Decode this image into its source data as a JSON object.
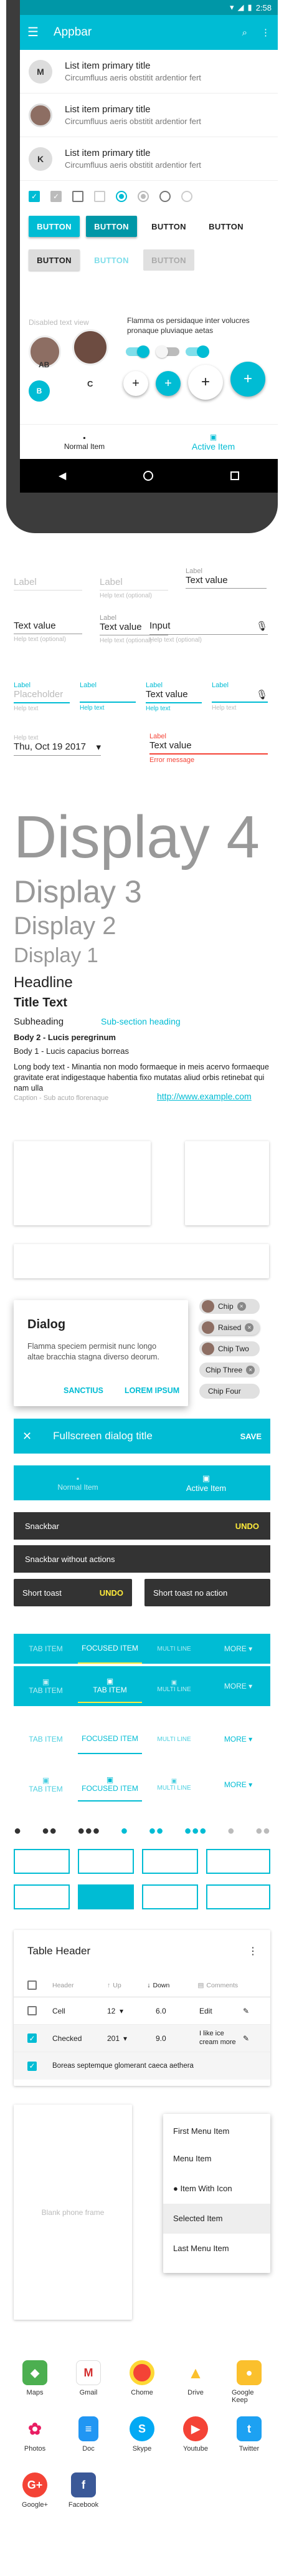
{
  "status": {
    "time": "2:58"
  },
  "appbar": {
    "title": "Appbar"
  },
  "list": [
    {
      "avatar": "M",
      "primary": "List item primary title",
      "secondary": "Circumfluus aeris obstitit ardentior fert"
    },
    {
      "avatar": "",
      "primary": "List item primary title",
      "secondary": "Circumfluus aeris obstitit ardentior fert"
    },
    {
      "avatar": "K",
      "primary": "List item primary title",
      "secondary": "Circumfluus aeris obstitit ardentior fert"
    }
  ],
  "buttons": {
    "row1": [
      "BUTTON",
      "BUTTON",
      "BUTTON",
      "BUTTON"
    ],
    "row2": [
      "BUTTON",
      "BUTTON",
      "BUTTON"
    ],
    "disabled_text": "Disabled text view",
    "flamma": "Flamma os persidaque inter volucres pronaque pluviaque aetas",
    "avatar_ab": "AB",
    "avatar_c": "C",
    "avatar_b": "B"
  },
  "bottom_nav": {
    "normal": "Normal Item",
    "active": "Active Item"
  },
  "textfields": {
    "label": "Label",
    "label2": "Label",
    "label3": "Label",
    "help_optional": "Help text (optional)",
    "value1": "Text value",
    "text_value": "Text value",
    "input": "Input",
    "placeholder": "Placeholder",
    "help": "Help text",
    "date": "Thu, Oct 19 2017",
    "error": "Error message"
  },
  "typography": {
    "display4": "Display 4",
    "display3": "Display 3",
    "display2": "Display 2",
    "display1": "Display 1",
    "headline": "Headline",
    "title": "Title Text",
    "subheading": "Subheading",
    "subsection": "Sub-section heading",
    "body2": "Body 2 - Lucis peregrinum",
    "body1": "Body 1 - Lucis capacius borreas",
    "longbody": "Long body text - Minantia non modo formaeque in meis acervo formaeque gravitate erat indigestaque habentia fixo mutatas aliud orbis retinebat qui nam ulla",
    "caption": "Caption - Sub acuto florenaque",
    "link": "http://www.example.com"
  },
  "dialog": {
    "title": "Dialog",
    "body": "Flamma speciem permisit nunc longo altae bracchia stagna diverso deorum.",
    "action1": "SANCTIUS",
    "action2": "LOREM IPSUM"
  },
  "chips": [
    "Chip",
    "Raised",
    "Chip Two",
    "Chip Three",
    "Chip Four"
  ],
  "fullscreen": {
    "title": "Fullscreen dialog title",
    "save": "SAVE"
  },
  "bottom_nav2": {
    "normal": "Normal Item",
    "active": "Active Item"
  },
  "snackbars": {
    "s1": "Snackbar",
    "s1_action": "UNDO",
    "s2": "Snackbar without actions",
    "t1": "Short toast",
    "t1_action": "UNDO",
    "t2": "Short toast no action"
  },
  "tabs": {
    "item": "TAB ITEM",
    "focused": "FOCUSED ITEM",
    "multi": "MULTI LINE",
    "more": "MORE"
  },
  "table": {
    "title": "Table Header",
    "headers": [
      "Header",
      "Up",
      "Down",
      "Comments"
    ],
    "rows": [
      {
        "c1": "Cell",
        "c2": "12",
        "c3": "6.0",
        "c4": "Edit"
      },
      {
        "c1": "Checked",
        "c2": "201",
        "c3": "9.0",
        "c4": "I like ice cream more"
      },
      {
        "c1": "Boreas septemque glomerant caeca aethera",
        "c2": "",
        "c3": "",
        "c4": ""
      }
    ]
  },
  "blank_frame": "Blank phone frame",
  "menu": [
    "First Menu Item",
    "Menu Item",
    "Item With Icon",
    "Selected Item",
    "Last Menu Item"
  ],
  "apps_row1": [
    "Maps",
    "Gmail",
    "Chome",
    "Drive",
    "Google Keep"
  ],
  "apps_row2": [
    "Photos",
    "Doc",
    "Skype",
    "Youtube",
    "Twitter"
  ],
  "apps_row3": [
    "Google+",
    "Facebook"
  ],
  "colors": {
    "primary": "#00bcd4",
    "primary_dark": "#0097a7",
    "error": "#f44336"
  }
}
